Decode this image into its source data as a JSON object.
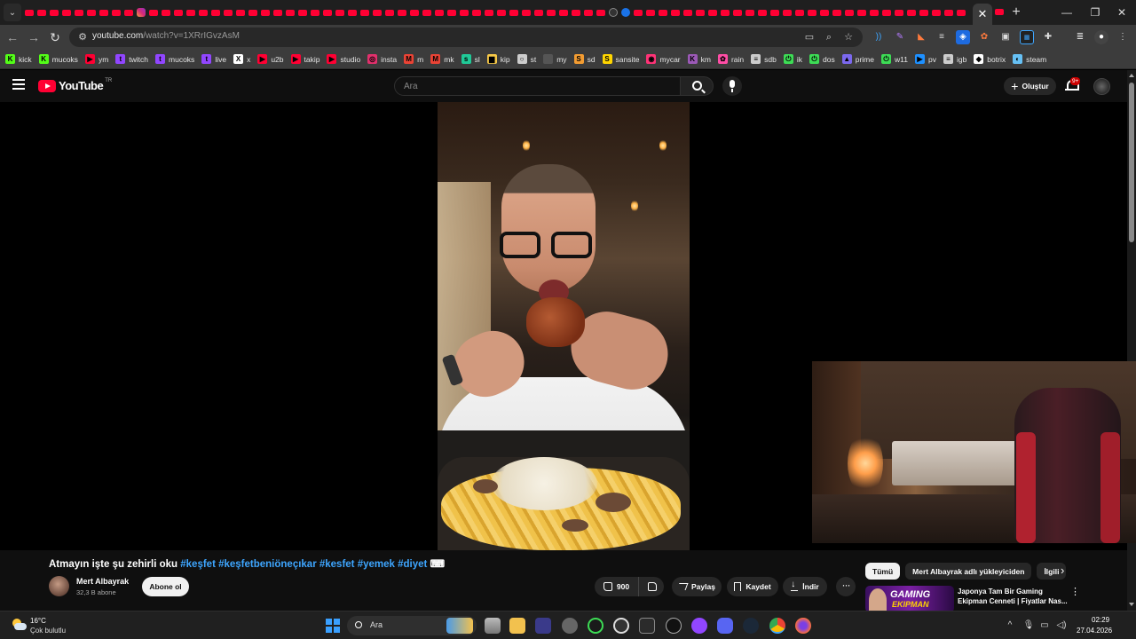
{
  "browser": {
    "url_host": "youtube.com",
    "url_path": "/watch?v=1XRrIGvzAsM",
    "tab_count_icons": "×"
  },
  "bookmarks": [
    {
      "label": "kick",
      "icon": "kick-icon",
      "color": "#53fc18",
      "glyph": "K"
    },
    {
      "label": "mucoks",
      "icon": "kick-icon",
      "color": "#53fc18",
      "glyph": "K"
    },
    {
      "label": "ym",
      "icon": "youtube-music-icon",
      "color": "#ff0033",
      "glyph": "▶"
    },
    {
      "label": "twitch",
      "icon": "twitch-icon",
      "color": "#9146ff",
      "glyph": "t"
    },
    {
      "label": "mucoks",
      "icon": "twitch-icon",
      "color": "#9146ff",
      "glyph": "t"
    },
    {
      "label": "live",
      "icon": "twitch-icon",
      "color": "#9146ff",
      "glyph": "t"
    },
    {
      "label": "x",
      "icon": "x-icon",
      "color": "#ffffff",
      "glyph": "X"
    },
    {
      "label": "u2b",
      "icon": "youtube-icon",
      "color": "#ff0033",
      "glyph": "▶"
    },
    {
      "label": "takip",
      "icon": "youtube-icon",
      "color": "#ff0033",
      "glyph": "▶"
    },
    {
      "label": "studio",
      "icon": "youtube-icon",
      "color": "#ff0033",
      "glyph": "▶"
    },
    {
      "label": "insta",
      "icon": "instagram-icon",
      "color": "#e1306c",
      "glyph": "◎"
    },
    {
      "label": "m",
      "icon": "gmail-icon",
      "color": "#ea4335",
      "glyph": "M"
    },
    {
      "label": "mk",
      "icon": "gmail-icon",
      "color": "#ea4335",
      "glyph": "M"
    },
    {
      "label": "sl",
      "icon": "sl-icon",
      "color": "#20c997",
      "glyph": "s"
    },
    {
      "label": "kip",
      "icon": "folder-icon",
      "color": "#f7c948",
      "glyph": "▆"
    },
    {
      "label": "st",
      "icon": "github-icon",
      "color": "#cccccc",
      "glyph": "○"
    },
    {
      "label": "my",
      "icon": "globe-icon",
      "color": "#555555",
      "glyph": ""
    },
    {
      "label": "sd",
      "icon": "sd-icon",
      "color": "#f39c32",
      "glyph": "S"
    },
    {
      "label": "sansite",
      "icon": "sansite-icon",
      "color": "#ffd500",
      "glyph": "S"
    },
    {
      "label": "mycar",
      "icon": "mycar-icon",
      "color": "#ff3377",
      "glyph": "◉"
    },
    {
      "label": "km",
      "icon": "km-icon",
      "color": "#9b59b6",
      "glyph": "K"
    },
    {
      "label": "rain",
      "icon": "rain-icon",
      "color": "#ff4da6",
      "glyph": "✿"
    },
    {
      "label": "sdb",
      "icon": "database-icon",
      "color": "#cccccc",
      "glyph": "≡"
    },
    {
      "label": "ik",
      "icon": "power-icon",
      "color": "#3ddc55",
      "glyph": "⏻"
    },
    {
      "label": "dos",
      "icon": "power-icon",
      "color": "#3ddc55",
      "glyph": "⏻"
    },
    {
      "label": "prime",
      "icon": "prime-icon",
      "color": "#7b68ee",
      "glyph": "▲"
    },
    {
      "label": "w11",
      "icon": "power-icon",
      "color": "#3ddc55",
      "glyph": "⏻"
    },
    {
      "label": "pv",
      "icon": "play-icon",
      "color": "#1e90ff",
      "glyph": "▶"
    },
    {
      "label": "igb",
      "icon": "database-icon",
      "color": "#cccccc",
      "glyph": "≡"
    },
    {
      "label": "botrix",
      "icon": "botrix-icon",
      "color": "#ffffff",
      "glyph": "◆"
    },
    {
      "label": "steam",
      "icon": "steam-icon",
      "color": "#66c0f4",
      "glyph": "◐"
    }
  ],
  "youtube": {
    "logo_text": "YouTube",
    "region": "TR",
    "search_placeholder": "Ara",
    "create_label": "Oluştur",
    "notif_count": "9+"
  },
  "video": {
    "title_plain": "Atmayın işte şu zehirli oku ",
    "title_tags": "#keşfet #keşfetbeniöneçıkar #kesfet #yemek #diyet",
    "title_emoji": "⌨",
    "channel_name": "Mert Albayrak",
    "channel_subs": "32,3 B abone",
    "subscribe_label": "Abone ol",
    "likes": "900",
    "share_label": "Paylaş",
    "save_label": "Kaydet",
    "download_label": "İndir"
  },
  "sidebar": {
    "chips": [
      {
        "label": "Tümü",
        "active": true
      },
      {
        "label": "Mert Albayrak adlı yükleyiciden",
        "active": false
      },
      {
        "label": "İlgili",
        "active": false
      }
    ],
    "rec_title": "Japonya Tam Bir Gaming Ekipman Cenneti | Fiyatlar Nas...",
    "rec_thumb_line1": "GAMING",
    "rec_thumb_line2": "EKIPMAN"
  },
  "taskbar": {
    "temp": "16°C",
    "condition": "Çok bulutlu",
    "search_label": "Ara",
    "time": "02:29",
    "date": "27.04.2026"
  }
}
